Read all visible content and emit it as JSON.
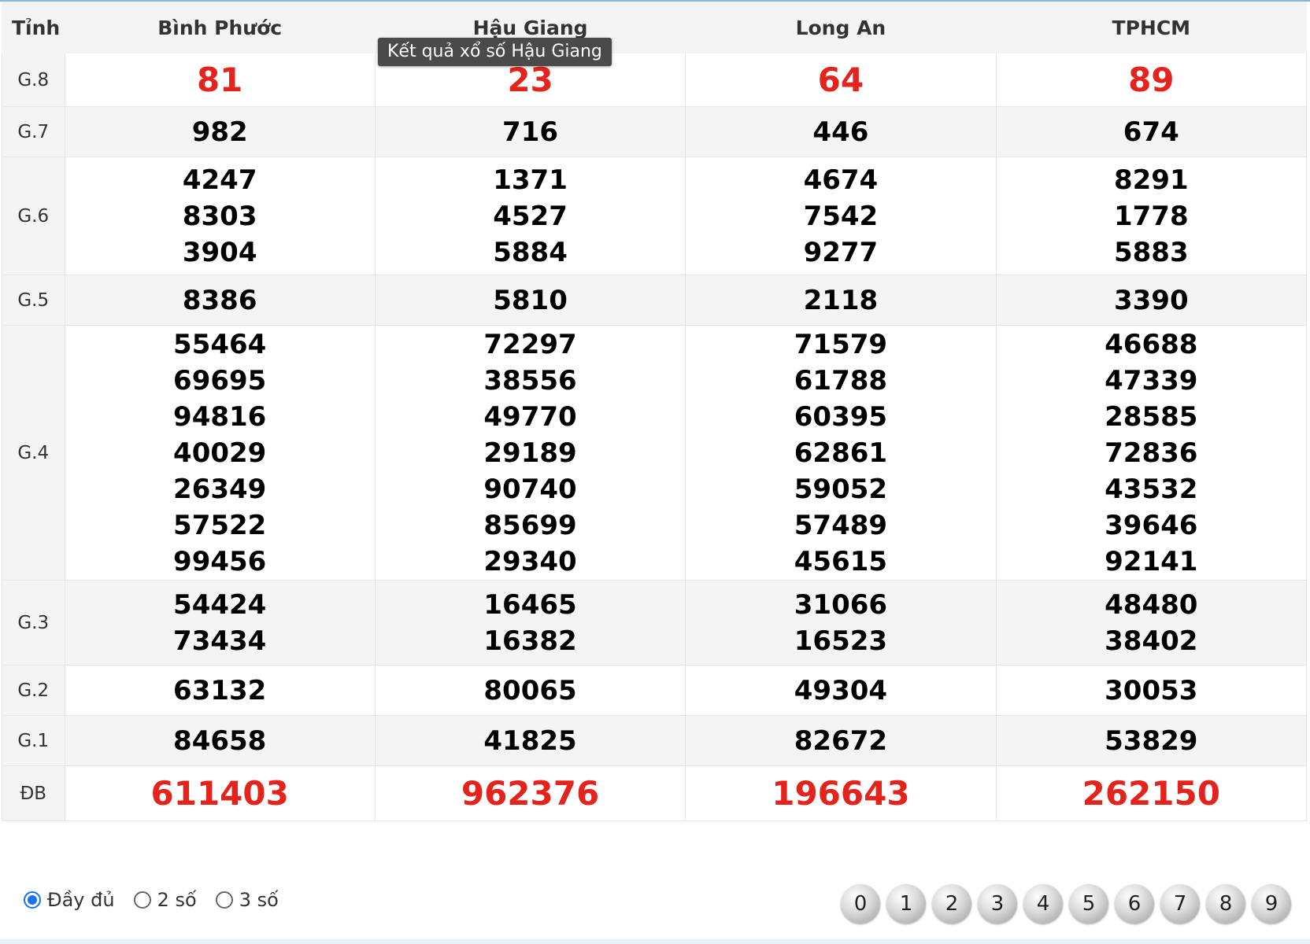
{
  "header": {
    "prize": "Tỉnh",
    "provinces": [
      "Bình Phước",
      "Hậu Giang",
      "Long An",
      "TPHCM"
    ]
  },
  "tooltip": "Kết quả xổ số Hậu Giang",
  "rows": [
    {
      "label": "G.8",
      "values": [
        [
          "81"
        ],
        [
          "23"
        ],
        [
          "64"
        ],
        [
          "89"
        ]
      ]
    },
    {
      "label": "G.7",
      "values": [
        [
          "982"
        ],
        [
          "716"
        ],
        [
          "446"
        ],
        [
          "674"
        ]
      ]
    },
    {
      "label": "G.6",
      "values": [
        [
          "4247",
          "8303",
          "3904"
        ],
        [
          "1371",
          "4527",
          "5884"
        ],
        [
          "4674",
          "7542",
          "9277"
        ],
        [
          "8291",
          "1778",
          "5883"
        ]
      ]
    },
    {
      "label": "G.5",
      "values": [
        [
          "8386"
        ],
        [
          "5810"
        ],
        [
          "2118"
        ],
        [
          "3390"
        ]
      ]
    },
    {
      "label": "G.4",
      "values": [
        [
          "55464",
          "69695",
          "94816",
          "40029",
          "26349",
          "57522",
          "99456"
        ],
        [
          "72297",
          "38556",
          "49770",
          "29189",
          "90740",
          "85699",
          "29340"
        ],
        [
          "71579",
          "61788",
          "60395",
          "62861",
          "59052",
          "57489",
          "45615"
        ],
        [
          "46688",
          "47339",
          "28585",
          "72836",
          "43532",
          "39646",
          "92141"
        ]
      ]
    },
    {
      "label": "G.3",
      "values": [
        [
          "54424",
          "73434"
        ],
        [
          "16465",
          "16382"
        ],
        [
          "31066",
          "16523"
        ],
        [
          "48480",
          "38402"
        ]
      ]
    },
    {
      "label": "G.2",
      "values": [
        [
          "63132"
        ],
        [
          "80065"
        ],
        [
          "49304"
        ],
        [
          "30053"
        ]
      ]
    },
    {
      "label": "G.1",
      "values": [
        [
          "84658"
        ],
        [
          "41825"
        ],
        [
          "82672"
        ],
        [
          "53829"
        ]
      ]
    },
    {
      "label": "ĐB",
      "values": [
        [
          "611403"
        ],
        [
          "962376"
        ],
        [
          "196643"
        ],
        [
          "262150"
        ]
      ]
    }
  ],
  "view_options": {
    "options": [
      "Đầy đủ",
      "2 số",
      "3 số"
    ],
    "selected": "Đầy đủ"
  },
  "digit_filters": [
    "0",
    "1",
    "2",
    "3",
    "4",
    "5",
    "6",
    "7",
    "8",
    "9"
  ],
  "colors": {
    "highlight_red": "#e3231c",
    "radio_blue": "#1a73e8",
    "row_alt": "#f4f4f4"
  }
}
